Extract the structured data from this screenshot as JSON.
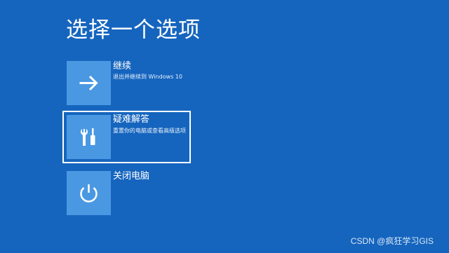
{
  "page": {
    "title": "选择一个选项"
  },
  "options": [
    {
      "title": "继续",
      "description": "退出并继续到 Windows 10",
      "icon": "arrow-right-icon"
    },
    {
      "title": "疑难解答",
      "description": "重置你的电脑或查看高级选项",
      "icon": "tools-icon",
      "selected": true
    },
    {
      "title": "关闭电脑",
      "description": "",
      "icon": "power-icon"
    }
  ],
  "watermark": "CSDN @疯狂学习GIS",
  "colors": {
    "background": "#1565be",
    "tile": "#4a98e2",
    "text": "#ffffff"
  }
}
